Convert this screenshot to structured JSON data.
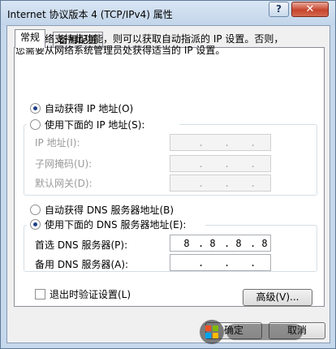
{
  "window": {
    "title": "Internet 协议版本 4 (TCP/IPv4) 属性",
    "help_label": "?",
    "close_label": "✕"
  },
  "tabs": [
    {
      "label": "常规"
    },
    {
      "label": "备用配置"
    }
  ],
  "intro": {
    "line1": "如果网络支持此功能，则可以获取自动指派的 IP 设置。否则，",
    "line2": "您需要从网络系统管理员处获得适当的 IP 设置。"
  },
  "ip": {
    "auto_label": "自动获得 IP 地址(O)",
    "manual_label": "使用下面的 IP 地址(S):",
    "auto_selected": true,
    "fields": [
      {
        "label": "IP 地址(I):",
        "value": [
          ".",
          ".",
          "."
        ]
      },
      {
        "label": "子网掩码(U):",
        "value": [
          ".",
          ".",
          "."
        ]
      },
      {
        "label": "默认网关(D):",
        "value": [
          ".",
          ".",
          "."
        ]
      }
    ]
  },
  "dns": {
    "auto_label": "自动获得 DNS 服务器地址(B)",
    "manual_label": "使用下面的 DNS 服务器地址(E):",
    "manual_selected": true,
    "preferred_label": "首选 DNS 服务器(P):",
    "preferred_octets": [
      "8",
      "8",
      "8",
      "8"
    ],
    "alternate_label": "备用 DNS 服务器(A):",
    "alternate_octets": [
      "",
      "",
      "",
      ""
    ]
  },
  "validate_label": "退出时验证设置(L)",
  "validate_checked": false,
  "advanced_label": "高级(V)...",
  "ok_label": "确定",
  "cancel_label": "取消",
  "icons": {
    "watermark": "win7-logo-watermark"
  }
}
